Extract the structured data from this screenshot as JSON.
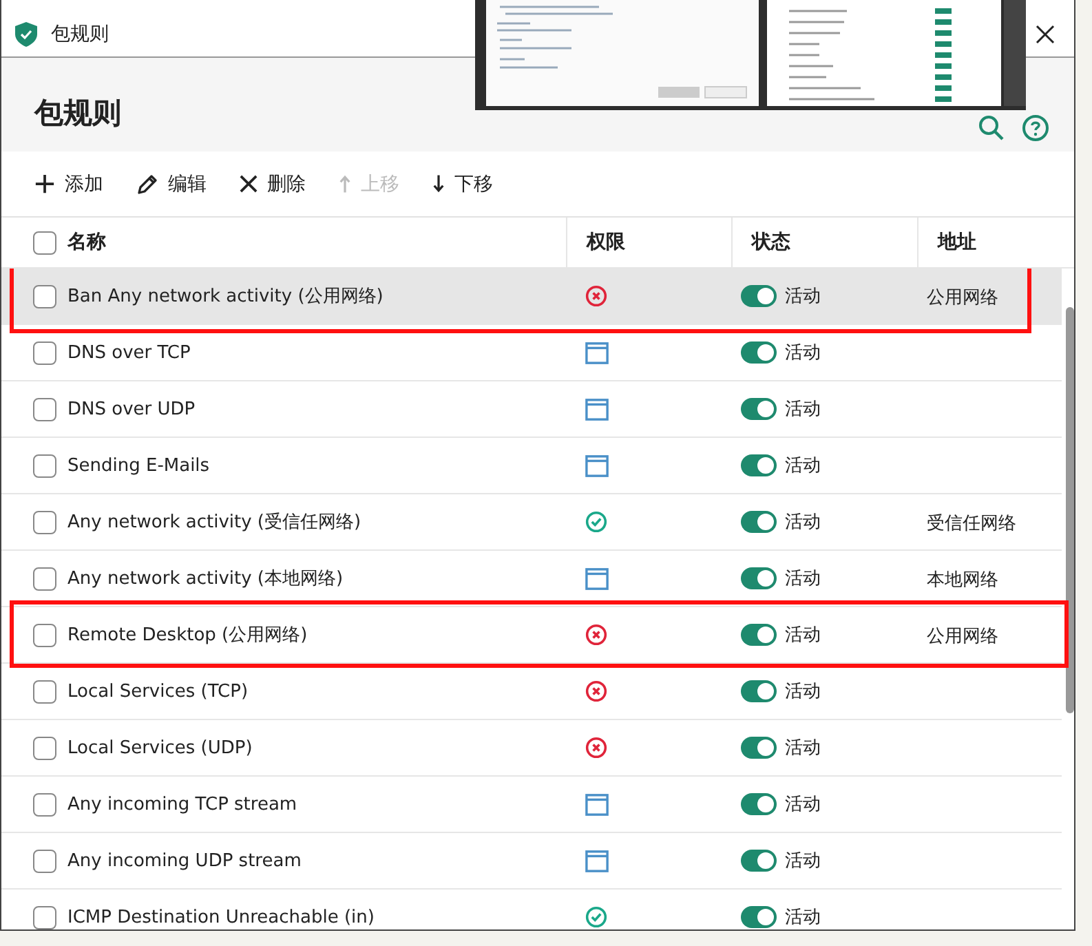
{
  "window": {
    "title": "包规则"
  },
  "header": {
    "title": "包规则"
  },
  "toolbar": [
    {
      "kind": "add",
      "label": "添加",
      "disabled": false
    },
    {
      "kind": "edit",
      "label": "编辑",
      "disabled": false
    },
    {
      "kind": "delete",
      "label": "删除",
      "disabled": false
    },
    {
      "kind": "up",
      "label": "上移",
      "disabled": true
    },
    {
      "kind": "down",
      "label": "下移",
      "disabled": false
    }
  ],
  "table": {
    "select_all_checked": false,
    "columns": [
      "名称",
      "权限",
      "状态",
      "地址"
    ],
    "rows": [
      {
        "name": "Ban Any network activity (公用网络)",
        "kind": "block",
        "active": true,
        "status": "活动",
        "address": "公用网络",
        "checked": false,
        "selected": true,
        "highlighted": true
      },
      {
        "name": "DNS over TCP",
        "kind": "ask",
        "active": true,
        "status": "活动",
        "checked": false,
        "selected": false,
        "highlighted": false
      },
      {
        "name": "DNS over UDP",
        "kind": "ask",
        "active": true,
        "status": "活动",
        "checked": false,
        "selected": false,
        "highlighted": false
      },
      {
        "name": "Sending E-Mails",
        "kind": "ask",
        "active": true,
        "status": "活动",
        "checked": false,
        "selected": false,
        "highlighted": false
      },
      {
        "name": "Any network activity (受信任网络)",
        "kind": "allow",
        "active": true,
        "status": "活动",
        "address": "受信任网络",
        "checked": false,
        "selected": false,
        "highlighted": false
      },
      {
        "name": "Any network activity (本地网络)",
        "kind": "ask",
        "active": true,
        "status": "活动",
        "address": "本地网络",
        "checked": false,
        "selected": false,
        "highlighted": false
      },
      {
        "name": "Remote Desktop (公用网络)",
        "kind": "block",
        "active": true,
        "status": "活动",
        "address": "公用网络",
        "checked": false,
        "selected": false,
        "highlighted": true
      },
      {
        "name": "Local Services (TCP)",
        "kind": "block",
        "active": true,
        "status": "活动",
        "checked": false,
        "selected": false,
        "highlighted": false
      },
      {
        "name": "Local Services (UDP)",
        "kind": "block",
        "active": true,
        "status": "活动",
        "checked": false,
        "selected": false,
        "highlighted": false
      },
      {
        "name": "Any incoming TCP stream",
        "kind": "ask",
        "active": true,
        "status": "活动",
        "checked": false,
        "selected": false,
        "highlighted": false
      },
      {
        "name": "Any incoming UDP stream",
        "kind": "ask",
        "active": true,
        "status": "活动",
        "checked": false,
        "selected": false,
        "highlighted": false
      },
      {
        "name": "ICMP Destination Unreachable (in)",
        "kind": "allow",
        "active": true,
        "status": "活动",
        "checked": false,
        "selected": false,
        "highlighted": false
      }
    ]
  }
}
